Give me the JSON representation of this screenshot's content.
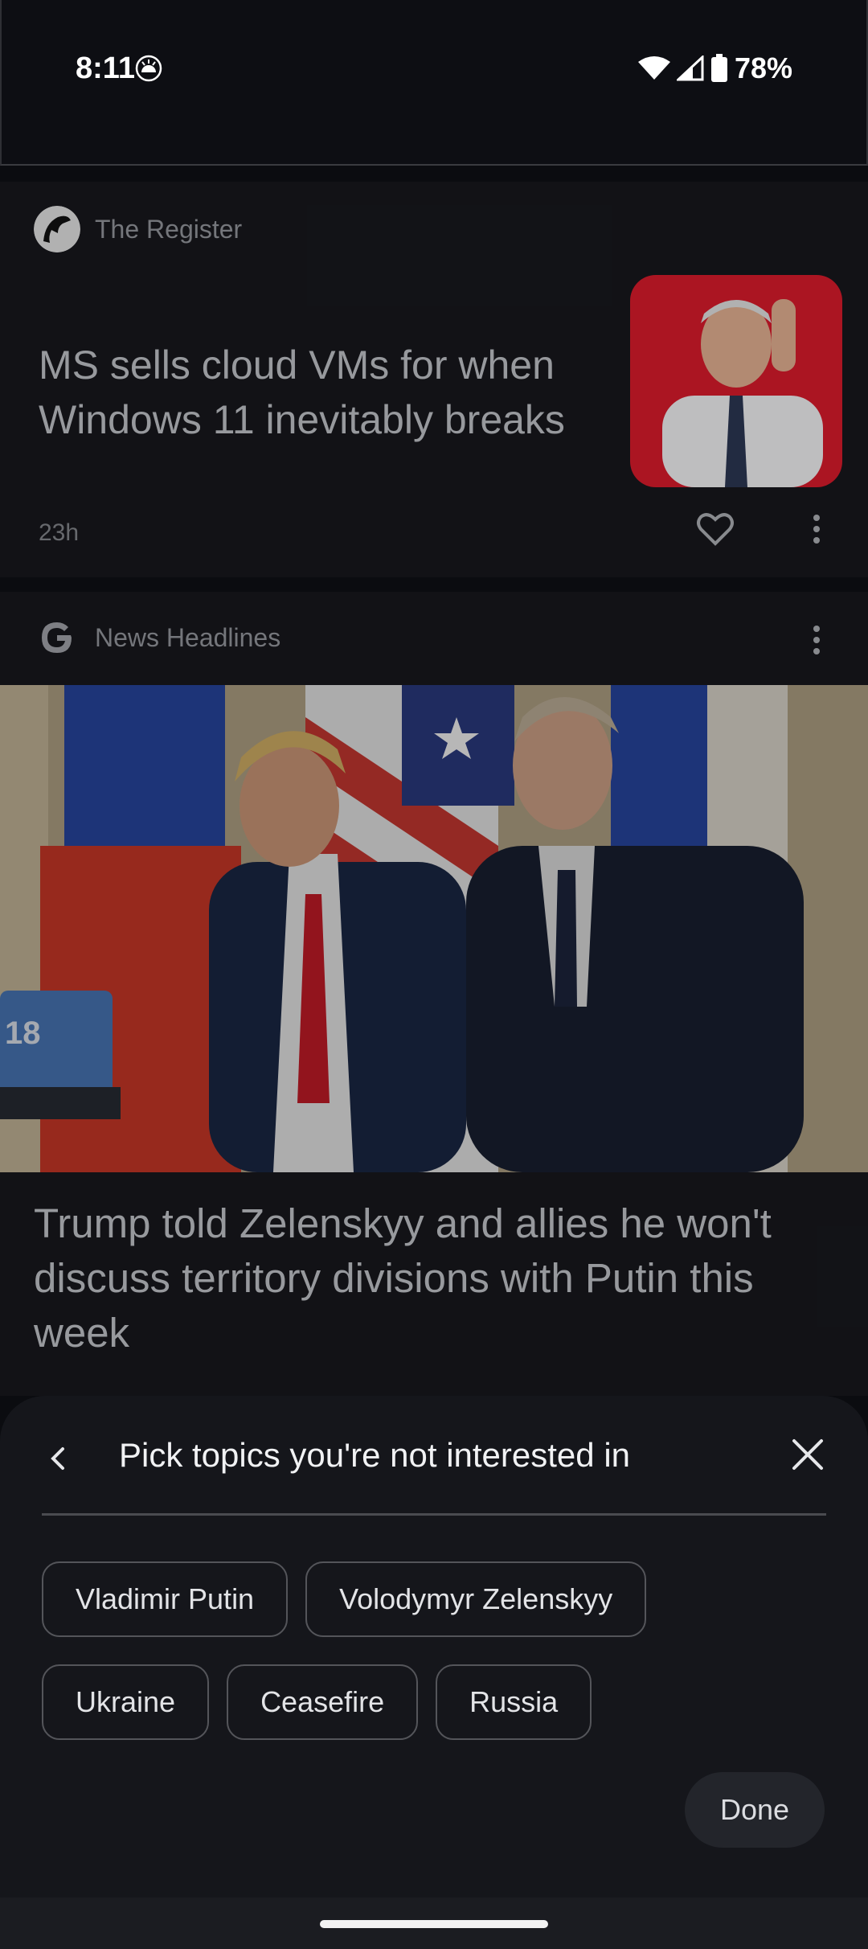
{
  "status_bar": {
    "time": "8:11",
    "battery_percent": "78%"
  },
  "card_register": {
    "source_name": "The Register",
    "headline": "MS sells cloud VMs for when Windows 11 inevitably breaks",
    "age": "23h"
  },
  "card_news": {
    "source_name": "News Headlines",
    "headline": "Trump told Zelenskyy and allies he won't discuss territory divisions with Putin this week"
  },
  "sheet": {
    "title": "Pick topics you're not interested in",
    "topics": [
      "Vladimir Putin",
      "Volodymyr Zelenskyy",
      "Ukraine",
      "Ceasefire",
      "Russia"
    ],
    "done_label": "Done"
  },
  "icons": {
    "back": "chevron-left-icon",
    "close": "close-icon",
    "like": "heart-icon",
    "more": "more-vert-icon"
  },
  "colors": {
    "background": "#0e0f14",
    "card": "#16171c",
    "sheet": "#15161b",
    "chip_border": "#54555a",
    "done_button": "#23252b"
  }
}
